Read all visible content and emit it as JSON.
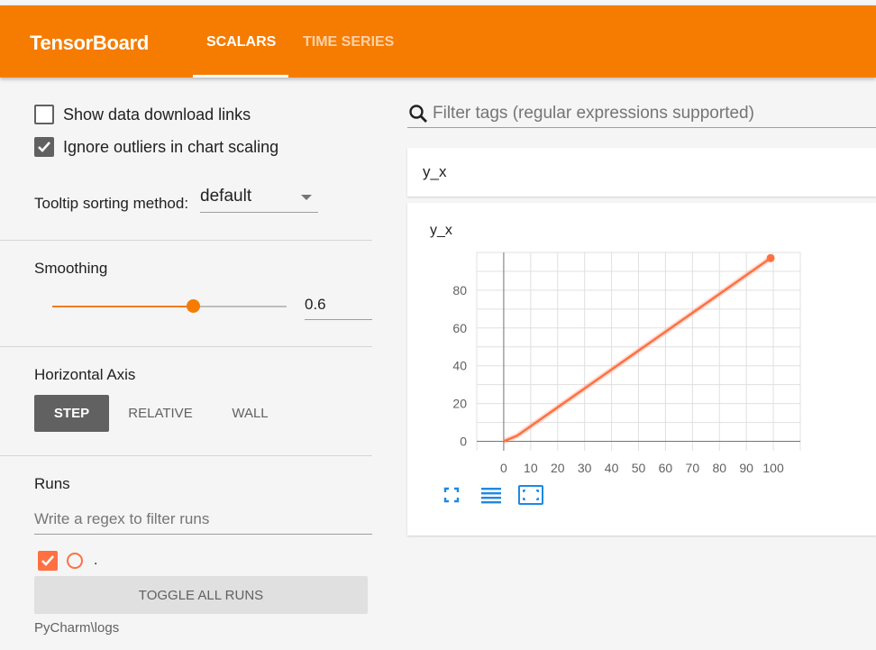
{
  "header": {
    "brand": "TensorBoard",
    "tabs": [
      {
        "label": "SCALARS",
        "active": true
      },
      {
        "label": "TIME SERIES",
        "active": false
      }
    ],
    "color": "#f57c00"
  },
  "sidebar": {
    "show_download_links": {
      "label": "Show data download links",
      "checked": false
    },
    "ignore_outliers": {
      "label": "Ignore outliers in chart scaling",
      "checked": true
    },
    "tooltip_sorting": {
      "label": "Tooltip sorting method:",
      "value": "default"
    },
    "smoothing": {
      "title": "Smoothing",
      "value": "0.6",
      "fraction": 0.6
    },
    "horizontal_axis": {
      "title": "Horizontal Axis",
      "options": [
        {
          "label": "STEP",
          "active": true
        },
        {
          "label": "RELATIVE",
          "active": false
        },
        {
          "label": "WALL",
          "active": false
        }
      ]
    },
    "runs": {
      "title": "Runs",
      "filter_placeholder": "Write a regex to filter runs",
      "items": [
        {
          "name": ".",
          "checked": true,
          "color": "#ff7043"
        }
      ],
      "toggle_label": "TOGGLE ALL RUNS",
      "logdir": "PyCharm\\logs"
    }
  },
  "main": {
    "search_placeholder": "Filter tags (regular expressions supported)",
    "card_header": "y_x"
  },
  "chart_data": {
    "type": "line",
    "title": "y_x",
    "xlabel": "",
    "ylabel": "",
    "x_ticks": [
      "0",
      "10",
      "20",
      "30",
      "40",
      "50",
      "60",
      "70",
      "80",
      "90",
      "100"
    ],
    "y_ticks": [
      "0",
      "20",
      "40",
      "60",
      "80"
    ],
    "xlim": [
      -10,
      110
    ],
    "ylim": [
      -5,
      100
    ],
    "grid": true,
    "series": [
      {
        "color": "#ff7043",
        "x": [
          0,
          5,
          10,
          20,
          30,
          40,
          50,
          60,
          70,
          80,
          90,
          99
        ],
        "y": [
          0,
          3,
          8,
          18,
          28,
          38,
          48,
          58,
          68,
          78,
          88,
          97
        ]
      }
    ]
  }
}
